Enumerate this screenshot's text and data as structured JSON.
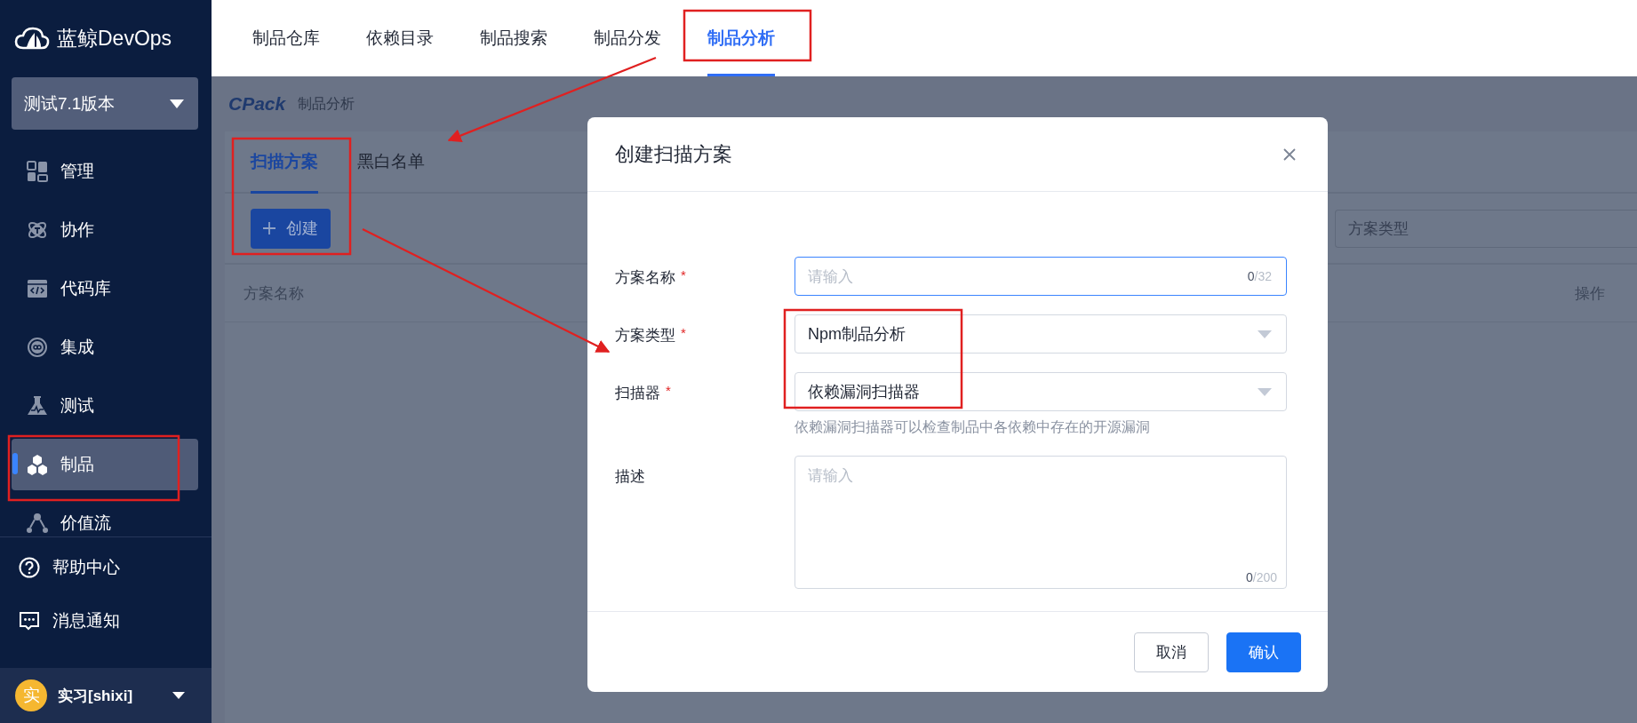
{
  "brand": {
    "name": "蓝鲸DevOps"
  },
  "project_selector": {
    "value": "测试7.1版本"
  },
  "sidebar": {
    "items": [
      {
        "label": "管理",
        "selected": false
      },
      {
        "label": "协作",
        "selected": false
      },
      {
        "label": "代码库",
        "selected": false
      },
      {
        "label": "集成",
        "selected": false
      },
      {
        "label": "测试",
        "selected": false
      },
      {
        "label": "制品",
        "selected": true
      },
      {
        "label": "价值流",
        "selected": false
      }
    ],
    "bottom_items": [
      {
        "label": "帮助中心"
      },
      {
        "label": "消息通知"
      }
    ]
  },
  "user": {
    "avatar_text": "实",
    "name": "实习[shixi]"
  },
  "top_nav": {
    "tabs": [
      {
        "label": "制品仓库",
        "selected": false
      },
      {
        "label": "依赖目录",
        "selected": false
      },
      {
        "label": "制品搜索",
        "selected": false
      },
      {
        "label": "制品分发",
        "selected": false
      },
      {
        "label": "制品分析",
        "selected": true
      }
    ]
  },
  "page_header": {
    "logo": "CPack",
    "title": "制品分析"
  },
  "content_tabs": [
    {
      "label": "扫描方案",
      "selected": true
    },
    {
      "label": "黑白名单",
      "selected": false
    }
  ],
  "create_button": {
    "label": "创建"
  },
  "filter": {
    "placeholder": "方案类型"
  },
  "table": {
    "columns": [
      "方案名称",
      "操作"
    ]
  },
  "dialog": {
    "title": "创建扫描方案",
    "fields": [
      {
        "kind": "input",
        "label": "方案名称",
        "required_mark": "*",
        "placeholder": "请输入",
        "count": "0",
        "limit": "/32",
        "focused": true
      },
      {
        "kind": "select",
        "label": "方案类型",
        "required_mark": "*",
        "value": "Npm制品分析"
      },
      {
        "kind": "select",
        "label": "扫描器",
        "required_mark": "*",
        "value": "依赖漏洞扫描器",
        "hint": "依赖漏洞扫描器可以检查制品中各依赖中存在的开源漏洞"
      },
      {
        "kind": "textarea",
        "label": "描述",
        "placeholder": "请输入",
        "count": "0",
        "limit": "/200"
      }
    ],
    "cancel_button": "取消",
    "confirm_button": "确认"
  }
}
